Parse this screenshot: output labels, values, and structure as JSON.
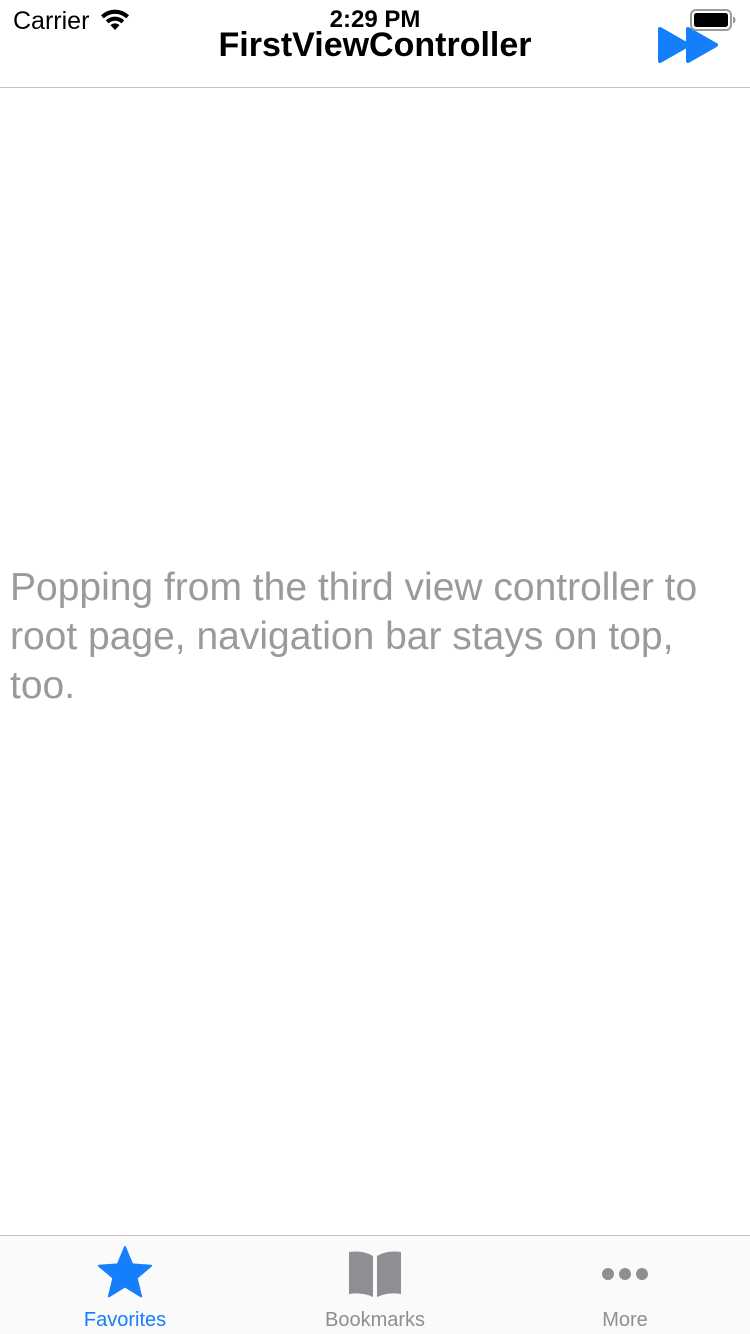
{
  "status_bar": {
    "carrier": "Carrier",
    "time": "2:29 PM",
    "wifi_icon": "wifi-icon",
    "battery_icon": "battery-icon"
  },
  "nav_bar": {
    "title": "FirstViewController",
    "right_button_icon": "fast-forward-icon"
  },
  "content": {
    "message": "Popping from the third view controller to root page, navigation bar stays on top, too."
  },
  "tab_bar": {
    "tabs": [
      {
        "label": "Favorites",
        "icon": "star-icon",
        "selected": true
      },
      {
        "label": "Bookmarks",
        "icon": "book-icon",
        "selected": false
      },
      {
        "label": "More",
        "icon": "more-icon",
        "selected": false
      }
    ]
  },
  "colors": {
    "accent": "#147efb",
    "inactive": "#8e8e93",
    "message_text": "#9a9a9a",
    "separator": "#c4c4c6"
  }
}
